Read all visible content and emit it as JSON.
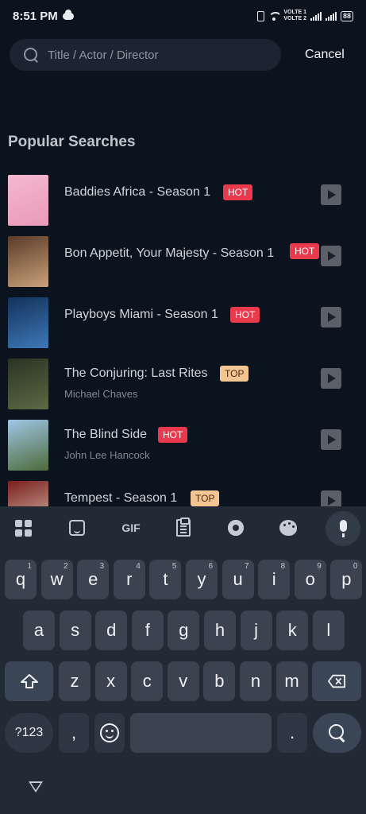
{
  "status_bar": {
    "time": "8:51 PM",
    "volte_top": "VOLTE 1",
    "volte_bottom": "VOLTE 2",
    "battery": "88"
  },
  "search": {
    "placeholder": "Title / Actor / Director",
    "cancel_label": "Cancel"
  },
  "popular": {
    "title": "Popular Searches",
    "items": [
      {
        "title": "Baddies Africa - Season 1",
        "subtitle": "",
        "badge": "HOT",
        "badge_type": "hot",
        "poster_colors": [
          "#f3b8cf",
          "#e99ab8"
        ]
      },
      {
        "title": "Bon Appetit, Your Majesty - Season 1",
        "subtitle": "",
        "badge": "HOT",
        "badge_type": "hot",
        "poster_colors": [
          "#5a3a28",
          "#c9a27a"
        ]
      },
      {
        "title": "Playboys Miami - Season 1",
        "subtitle": "",
        "badge": "HOT",
        "badge_type": "hot",
        "poster_colors": [
          "#13325a",
          "#3d78b8"
        ]
      },
      {
        "title": "The Conjuring: Last Rites",
        "subtitle": "Michael Chaves",
        "badge": "TOP",
        "badge_type": "top",
        "poster_colors": [
          "#2a3324",
          "#5c6a44"
        ]
      },
      {
        "title": "The Blind Side",
        "subtitle": "John Lee Hancock",
        "badge": "HOT",
        "badge_type": "hot",
        "poster_colors": [
          "#9fc6e6",
          "#4d6b3a"
        ]
      },
      {
        "title": "Tempest - Season 1",
        "subtitle": "",
        "badge": "TOP",
        "badge_type": "top",
        "poster_colors": [
          "#7a1d1d",
          "#d7c3b0"
        ]
      }
    ]
  },
  "keyboard": {
    "toolbar": {
      "gif_label": "GIF"
    },
    "row1": [
      {
        "key": "q",
        "num": "1"
      },
      {
        "key": "w",
        "num": "2"
      },
      {
        "key": "e",
        "num": "3"
      },
      {
        "key": "r",
        "num": "4"
      },
      {
        "key": "t",
        "num": "5"
      },
      {
        "key": "y",
        "num": "6"
      },
      {
        "key": "u",
        "num": "7"
      },
      {
        "key": "i",
        "num": "8"
      },
      {
        "key": "o",
        "num": "9"
      },
      {
        "key": "p",
        "num": "0"
      }
    ],
    "row2": [
      "a",
      "s",
      "d",
      "f",
      "g",
      "h",
      "j",
      "k",
      "l"
    ],
    "row3": [
      "z",
      "x",
      "c",
      "v",
      "b",
      "n",
      "m"
    ],
    "symbols_label": "?123",
    "comma": ",",
    "period": "."
  }
}
